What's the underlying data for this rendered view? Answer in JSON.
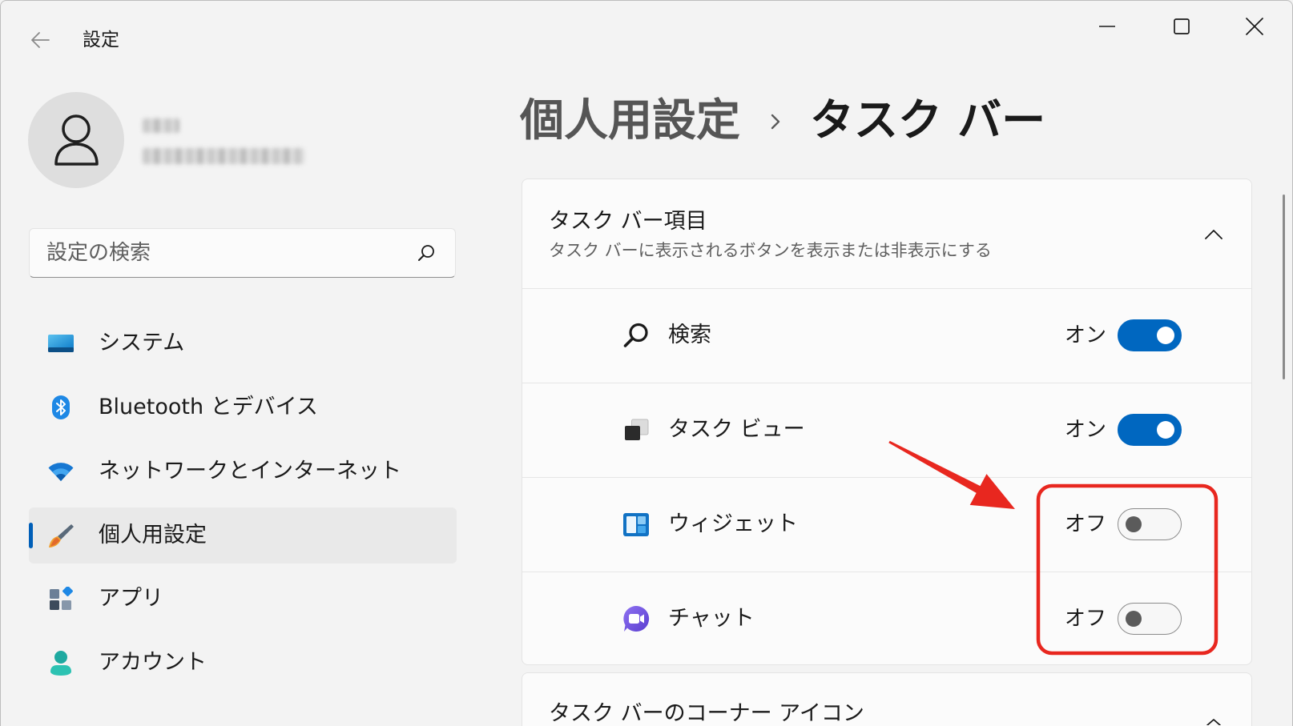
{
  "window": {
    "title": "設定",
    "controls": [
      "minimize-icon",
      "maximize-icon",
      "close-icon"
    ]
  },
  "search": {
    "placeholder": "設定の検索",
    "value": ""
  },
  "nav": {
    "selected_index": 3,
    "items": [
      {
        "label": "システム",
        "icon": "system-icon"
      },
      {
        "label": "Bluetooth とデバイス",
        "icon": "bluetooth-icon"
      },
      {
        "label": "ネットワークとインターネット",
        "icon": "wifi-icon"
      },
      {
        "label": "個人用設定",
        "icon": "paintbrush-icon"
      },
      {
        "label": "アプリ",
        "icon": "apps-icon"
      },
      {
        "label": "アカウント",
        "icon": "account-icon"
      }
    ]
  },
  "breadcrumb": {
    "parent": "個人用設定",
    "current": "タスク バー"
  },
  "taskbar_items": {
    "title": "タスク バー項目",
    "subtitle": "タスク バーに表示されるボタンを表示または非表示にする",
    "expanded": true,
    "rows": [
      {
        "label": "検索",
        "state_label": "オン",
        "on": true,
        "icon": "search-icon"
      },
      {
        "label": "タスク ビュー",
        "state_label": "オン",
        "on": true,
        "icon": "task-view-icon"
      },
      {
        "label": "ウィジェット",
        "state_label": "オフ",
        "on": false,
        "icon": "widgets-icon"
      },
      {
        "label": "チャット",
        "state_label": "オフ",
        "on": false,
        "icon": "chat-icon"
      }
    ]
  },
  "corner_icons": {
    "title": "タスク バーのコーナー アイコン"
  },
  "colors": {
    "accent": "#0067c0",
    "annotation": "#e8271f",
    "background": "#f3f3f3",
    "card": "#fbfbfb"
  }
}
